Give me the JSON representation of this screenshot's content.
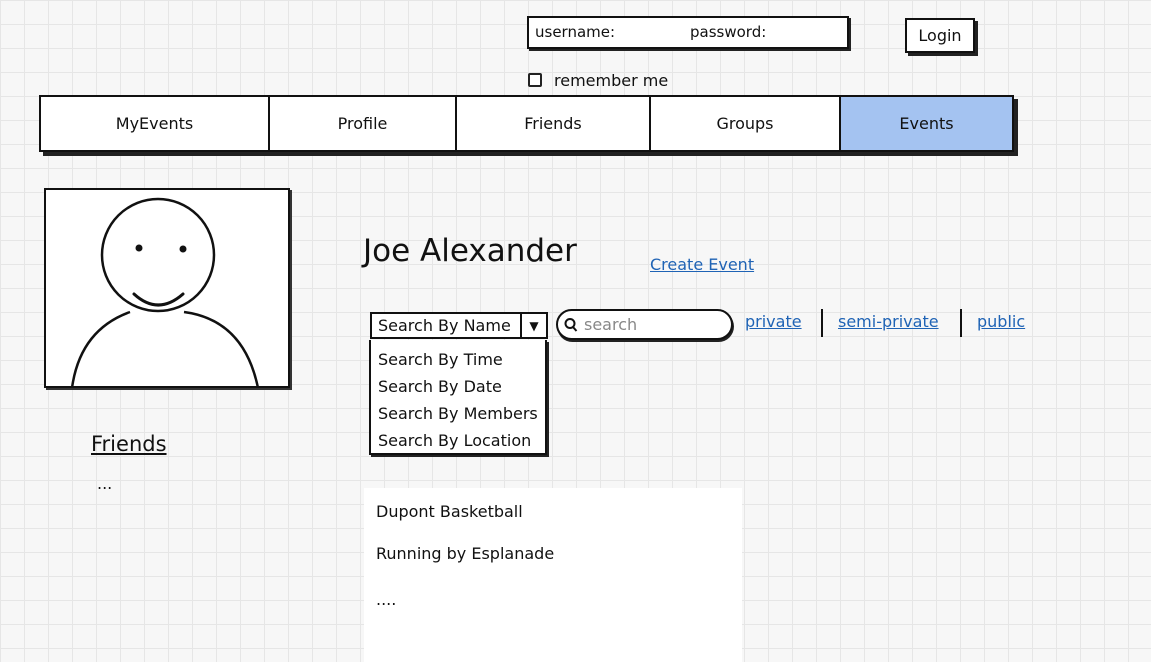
{
  "login": {
    "username_label": "username:",
    "password_label": "password:",
    "button": "Login",
    "remember_label": "remember me"
  },
  "nav": {
    "tabs": [
      {
        "label": "MyEvents"
      },
      {
        "label": "Profile"
      },
      {
        "label": "Friends"
      },
      {
        "label": "Groups"
      },
      {
        "label": "Events"
      }
    ],
    "active": "Events",
    "active_color": "#a4c3f1"
  },
  "profile": {
    "name": "Joe Alexander",
    "create_event": "Create Event",
    "avatar_icon": "smiley-face-icon"
  },
  "sidebar": {
    "friends_heading": "Friends",
    "friends_more": "..."
  },
  "search": {
    "select_value": "Search By Name",
    "options": [
      "Search By Time",
      "Search By Date",
      "Search By Members",
      "Search By Location"
    ],
    "placeholder": "search",
    "filters": [
      "private",
      "semi-private",
      "public"
    ],
    "link_color": "#1f63b5"
  },
  "events": {
    "items": [
      "Dupont Basketball",
      "Running by Esplanade",
      "...."
    ]
  }
}
